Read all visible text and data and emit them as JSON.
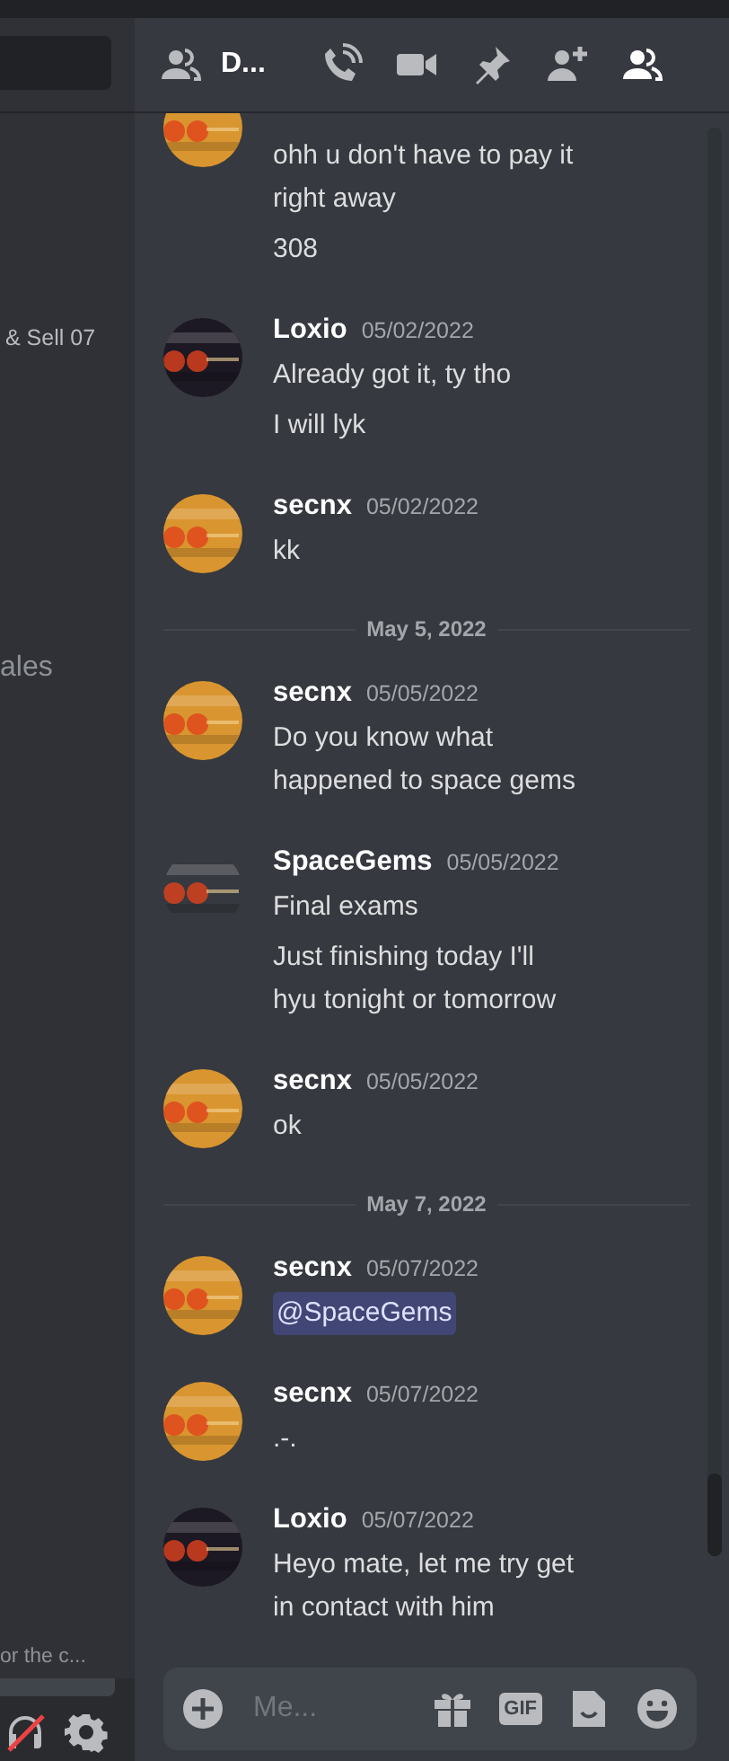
{
  "sidebar": {
    "items": [
      {
        "label": "& Sell 07",
        "kind": "small"
      },
      {
        "label": "ales",
        "kind": "large"
      },
      {
        "label": "or the c...",
        "kind": "hint"
      }
    ]
  },
  "header": {
    "title": "D..."
  },
  "messages": [
    {
      "kind": "group",
      "color": "#d9952f",
      "lines": [
        "ohh u don't have to pay it right away",
        "308"
      ]
    },
    {
      "kind": "group",
      "author": "Loxio",
      "time": "05/02/2022",
      "color": "#1c1824",
      "lines": [
        "Already got it, ty tho",
        "I will lyk"
      ]
    },
    {
      "kind": "group",
      "author": "secnx",
      "time": "05/02/2022",
      "color": "#d9952f",
      "lines": [
        "kk"
      ]
    },
    {
      "kind": "divider",
      "label": "May 5, 2022"
    },
    {
      "kind": "group",
      "author": "secnx",
      "time": "05/05/2022",
      "color": "#d9952f",
      "lines": [
        "Do you know what happened to space gems"
      ]
    },
    {
      "kind": "group",
      "author": "SpaceGems",
      "time": "05/05/2022",
      "color": "#36393f",
      "lines": [
        "Final exams",
        "Just finishing today I'll hyu tonight or tomorrow"
      ]
    },
    {
      "kind": "group",
      "author": "secnx",
      "time": "05/05/2022",
      "color": "#d9952f",
      "lines": [
        "ok"
      ]
    },
    {
      "kind": "divider",
      "label": "May 7, 2022"
    },
    {
      "kind": "group",
      "author": "secnx",
      "time": "05/07/2022",
      "color": "#d9952f",
      "mention": true,
      "lines": [
        "@SpaceGems"
      ]
    },
    {
      "kind": "group",
      "author": "secnx",
      "time": "05/07/2022",
      "color": "#d9952f",
      "lines": [
        ".-."
      ]
    },
    {
      "kind": "group",
      "author": "Loxio",
      "time": "05/07/2022",
      "color": "#1c1824",
      "lines": [
        "Heyo mate, let me try get in contact with him"
      ]
    }
  ],
  "composer": {
    "placeholder": "Me...",
    "gif": "GIF"
  }
}
